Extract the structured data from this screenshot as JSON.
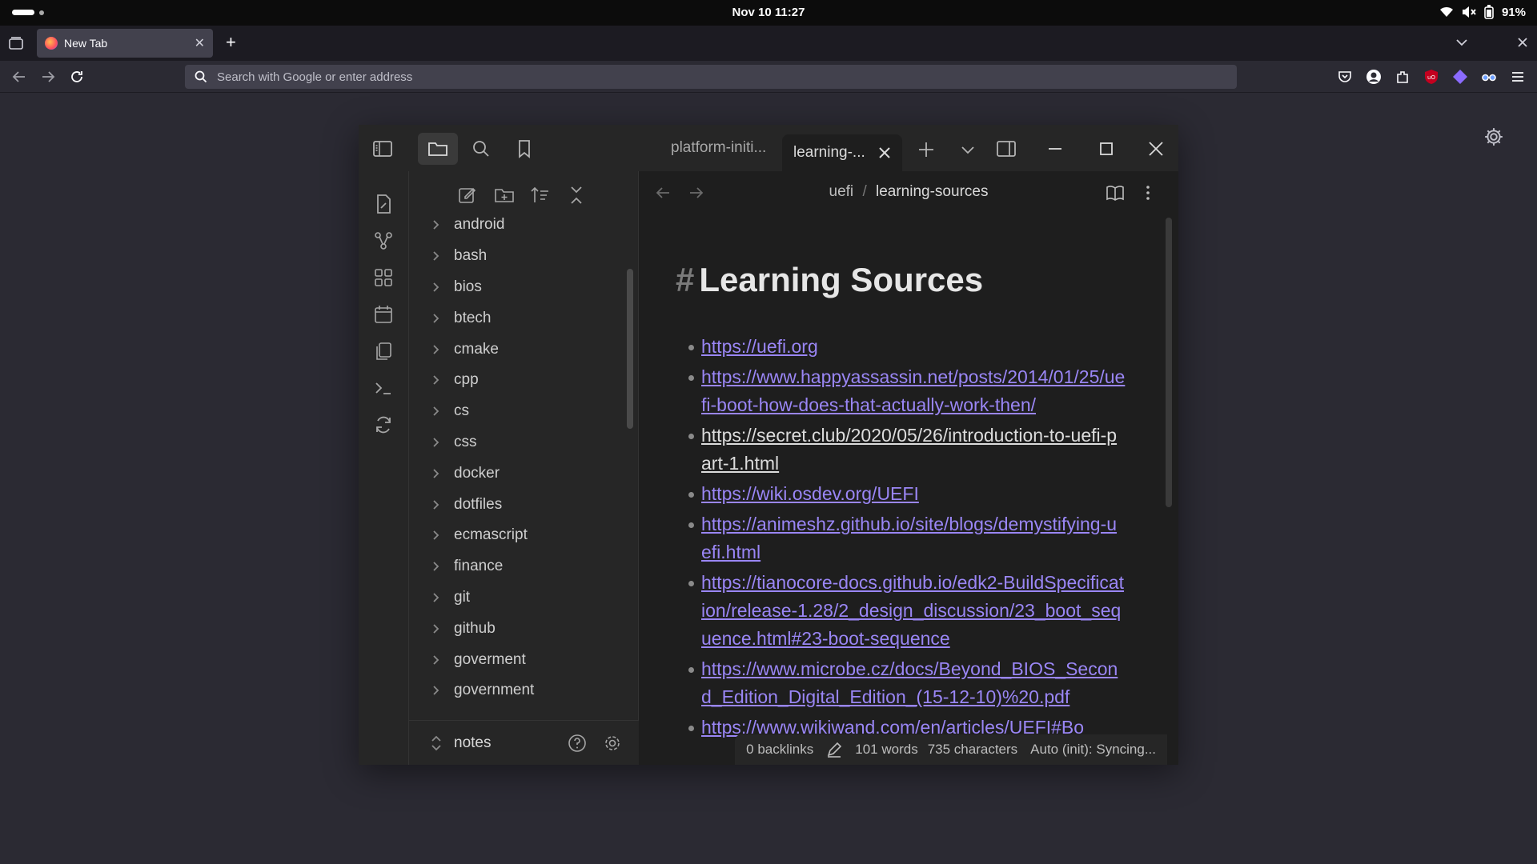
{
  "system": {
    "clock": "Nov 10  11:27",
    "battery": "91%",
    "icons": [
      "wifi-icon",
      "volume-muted-icon",
      "battery-icon"
    ]
  },
  "browser": {
    "tab_title": "New Tab",
    "new_tab_label": "+",
    "url_placeholder": "Search with Google or enter address",
    "extension_icons": [
      "pocket-icon",
      "account-icon",
      "extensions-icon",
      "ublock-icon",
      "proton-icon",
      "glasses-icon",
      "menu-icon"
    ]
  },
  "obsidian": {
    "tabs": [
      {
        "label": "platform-initi..."
      },
      {
        "label": "learning-..."
      }
    ],
    "ribbon_icons": [
      "new-note-icon",
      "graph-icon",
      "canvas-icon",
      "calendar-icon",
      "templates-icon",
      "terminal-icon",
      "sync-icon"
    ],
    "explorer": {
      "folders": [
        "android",
        "bash",
        "bios",
        "btech",
        "cmake",
        "cpp",
        "cs",
        "css",
        "docker",
        "dotfiles",
        "ecmascript",
        "finance",
        "git",
        "github",
        "goverment",
        "government"
      ],
      "vault_name": "notes"
    },
    "breadcrumb": {
      "parent": "uefi",
      "separator": "/",
      "current": "learning-sources"
    },
    "note": {
      "heading_mark": "#",
      "heading": "Learning Sources",
      "links": [
        "https://uefi.org",
        "https://www.happyassassin.net/posts/2014/01/25/uefi-boot-how-does-that-actually-work-then/",
        "https://secret.club/2020/05/26/introduction-to-uefi-part-1.html",
        "https://wiki.osdev.org/UEFI",
        "https://animeshz.github.io/site/blogs/demystifying-uefi.html",
        "https://tianocore-docs.github.io/edk2-BuildSpecification/release-1.28/2_design_discussion/23_boot_sequence.html#23-boot-sequence",
        "https://www.microbe.cz/docs/Beyond_BIOS_Second_Edition_Digital_Edition_(15-12-10)%20.pdf",
        "https://www.wikiwand.com/en/articles/UEFI#Bo"
      ]
    },
    "status_bar": {
      "backlinks": "0 backlinks",
      "words": "101 words",
      "characters": "735 characters",
      "sync": "Auto (init): Syncing..."
    }
  }
}
